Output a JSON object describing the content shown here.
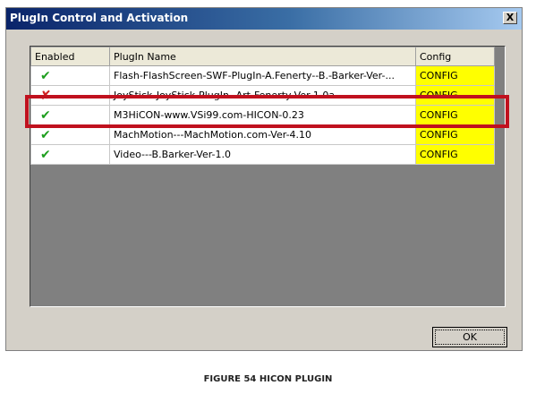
{
  "dialog": {
    "title": "PlugIn Control and Activation",
    "close_label": "X",
    "ok_label": "OK"
  },
  "table": {
    "columns": [
      "Enabled",
      "PlugIn Name",
      "Config"
    ],
    "rows": [
      {
        "enabled": true,
        "name": "Flash-FlashScreen-SWF-PlugIn-A.Fenerty--B.-Barker-Ver-...",
        "config": "CONFIG"
      },
      {
        "enabled": false,
        "name": "JoyStick-JoyStick-PlugIn--Art-Fenerty-Ver-1.0a",
        "config": "CONFIG"
      },
      {
        "enabled": true,
        "name": "M3HiCON-www.VSi99.com-HICON-0.23",
        "config": "CONFIG"
      },
      {
        "enabled": true,
        "name": "MachMotion---MachMotion.com-Ver-4.10",
        "config": "CONFIG"
      },
      {
        "enabled": true,
        "name": "Video---B.Barker-Ver-1.0",
        "config": "CONFIG"
      }
    ]
  },
  "icons": {
    "enabled": "green-check-icon",
    "disabled": "red-x-icon"
  },
  "colors": {
    "config_highlight": "#ffff00",
    "selection_outline": "#c0111e",
    "titlebar": "#0a246a"
  },
  "caption": "FIGURE 54 HICON PLUGIN"
}
